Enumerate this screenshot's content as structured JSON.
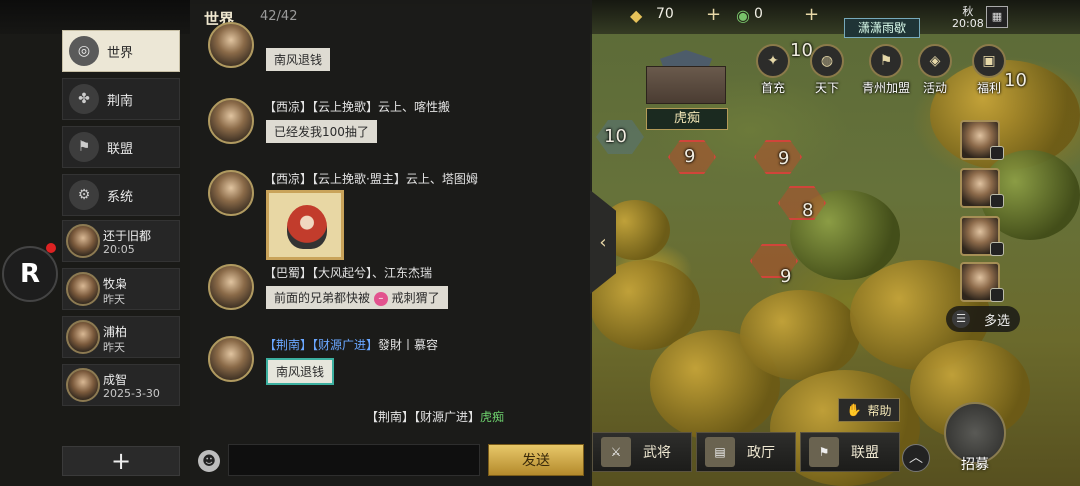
{
  "topbar": {
    "gold_value": "70",
    "jade_value": "0",
    "plus_label": "+"
  },
  "city_name": "潇潇雨歇",
  "season": {
    "name": "秋",
    "time": "20:08"
  },
  "map_labels": {
    "city": "虎痴",
    "hex_numbers": [
      "10",
      "9",
      "9",
      "8",
      "9",
      "10",
      "10"
    ]
  },
  "top_icons": [
    {
      "name": "first-charge",
      "label": "首充",
      "icon": "gift-icon"
    },
    {
      "name": "world",
      "label": "天下",
      "icon": "world-icon"
    },
    {
      "name": "qingzhou-alliance",
      "label": "青州加盟",
      "icon": "alliance-icon"
    },
    {
      "name": "events",
      "label": "活动",
      "icon": "event-icon"
    },
    {
      "name": "welfare",
      "label": "福利",
      "icon": "welfare-icon"
    }
  ],
  "chat": {
    "title": "世界",
    "count": "42/42",
    "messages": [
      {
        "header_prefix": "",
        "header": "",
        "text": "南风退钱"
      },
      {
        "header_prefix": "",
        "header": "【西凉】【云上挽歌】云上、喀性搬",
        "text": "已经发我100抽了"
      },
      {
        "header_prefix": "",
        "header": "【西凉】【云上挽歌·盟主】云上、塔图姆",
        "text": ""
      },
      {
        "header_prefix": "",
        "header": "【巴蜀】【大风起兮】、江东杰瑞",
        "text_before": "前面的兄弟都快被",
        "text_after": "戒刺猬了"
      },
      {
        "header_prefix": "【荆南】【财源广进】",
        "header": "發財丨慕容",
        "text": "南风退钱"
      }
    ],
    "last_line_prefix": "【荆南】【财源广进】",
    "last_line_name": "虎痴",
    "input_placeholder": "",
    "send_label": "发送",
    "emoji_label": "☻"
  },
  "sidebar": {
    "nav": [
      {
        "label": "世界",
        "icon": "globe-icon",
        "active": true
      },
      {
        "label": "荆南",
        "icon": "region-icon",
        "active": false
      },
      {
        "label": "联盟",
        "icon": "alliance-icon",
        "active": false
      },
      {
        "label": "系统",
        "icon": "system-icon",
        "active": false
      }
    ],
    "contacts": [
      {
        "name": "还于旧都",
        "time": "20:05"
      },
      {
        "name": "牧枭",
        "time": "昨天"
      },
      {
        "name": "浦柏",
        "time": "昨天"
      },
      {
        "name": "成智",
        "time": "2025-3-30"
      }
    ],
    "add_label": "+"
  },
  "floating_button": {
    "label": "R"
  },
  "right_panel": {
    "multi_select_label": "多选",
    "help_label": "帮助",
    "recruit_label": "招募"
  },
  "bottom_bar": [
    {
      "label": "武将",
      "icon": "general-icon"
    },
    {
      "label": "政厅",
      "icon": "hall-icon"
    },
    {
      "label": "联盟",
      "icon": "alliance-icon"
    }
  ]
}
